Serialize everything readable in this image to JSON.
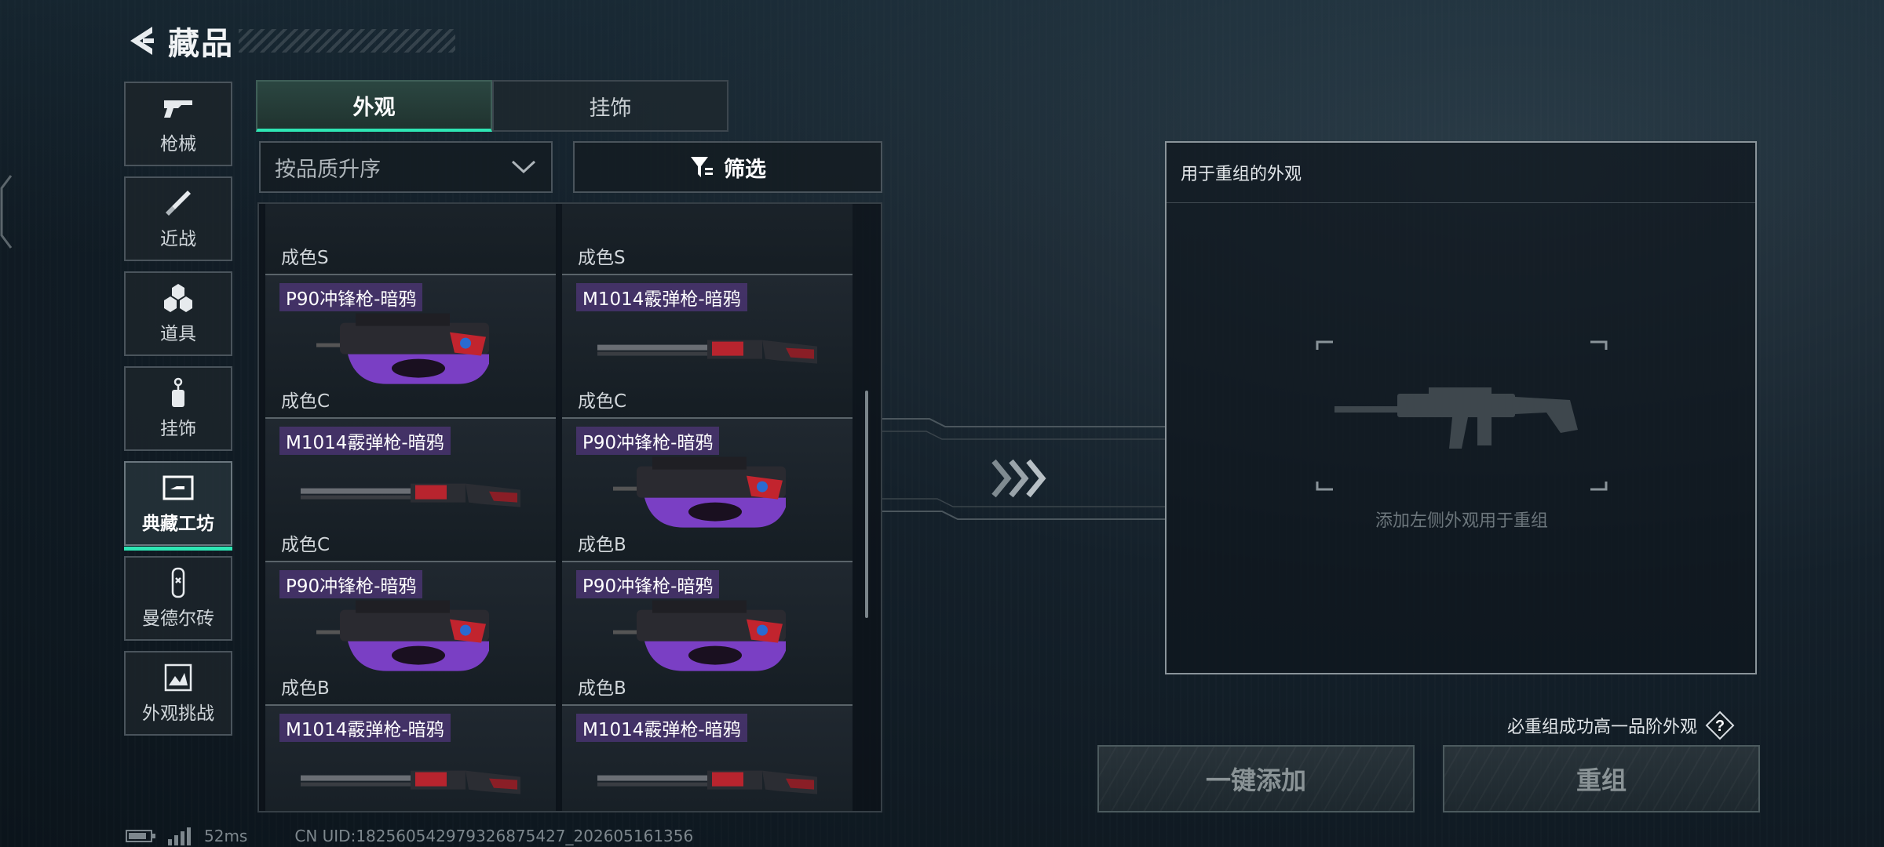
{
  "header": {
    "title": "藏品"
  },
  "nav": {
    "items": [
      {
        "label": "枪械",
        "icon": "gun-icon"
      },
      {
        "label": "近战",
        "icon": "knife-icon"
      },
      {
        "label": "道具",
        "icon": "items-icon"
      },
      {
        "label": "挂饰",
        "icon": "charm-icon"
      },
      {
        "label": "典藏工坊",
        "icon": "workshop-icon",
        "active": true
      },
      {
        "label": "曼德尔砖",
        "icon": "brick-icon"
      },
      {
        "label": "外观挑战",
        "icon": "challenge-icon"
      }
    ]
  },
  "tabs": [
    {
      "label": "外观",
      "active": true
    },
    {
      "label": "挂饰",
      "active": false
    }
  ],
  "sort": {
    "value": "按品质升序"
  },
  "filter": {
    "label": "筛选"
  },
  "grid": {
    "cards": [
      {
        "name": "",
        "grade": "成色S",
        "gun": "rifle-green"
      },
      {
        "name": "",
        "grade": "成色S",
        "gun": "rifle-teal"
      },
      {
        "name": "P90冲锋枪-暗鸦",
        "grade": "成色C",
        "gun": "p90"
      },
      {
        "name": "M1014霰弹枪-暗鸦",
        "grade": "成色C",
        "gun": "shotgun"
      },
      {
        "name": "M1014霰弹枪-暗鸦",
        "grade": "成色C",
        "gun": "shotgun"
      },
      {
        "name": "P90冲锋枪-暗鸦",
        "grade": "成色B",
        "gun": "p90"
      },
      {
        "name": "P90冲锋枪-暗鸦",
        "grade": "成色B",
        "gun": "p90"
      },
      {
        "name": "P90冲锋枪-暗鸦",
        "grade": "成色B",
        "gun": "p90"
      },
      {
        "name": "M1014霰弹枪-暗鸦",
        "grade": "",
        "gun": "shotgun"
      },
      {
        "name": "M1014霰弹枪-暗鸦",
        "grade": "",
        "gun": "shotgun"
      }
    ]
  },
  "recombine": {
    "title": "用于重组的外观",
    "hint": "添加左侧外观用于重组"
  },
  "guarantee": {
    "text": "必重组成功高一品阶外观",
    "help": "?"
  },
  "buttons": {
    "add_all": "一键添加",
    "recombine": "重组"
  },
  "status": {
    "ping": "52ms",
    "uid": "CN UID:18256054297932687542​7_202605161356"
  },
  "colors": {
    "accent": "#2ee6b4",
    "name_tag": "#6e40aa"
  }
}
